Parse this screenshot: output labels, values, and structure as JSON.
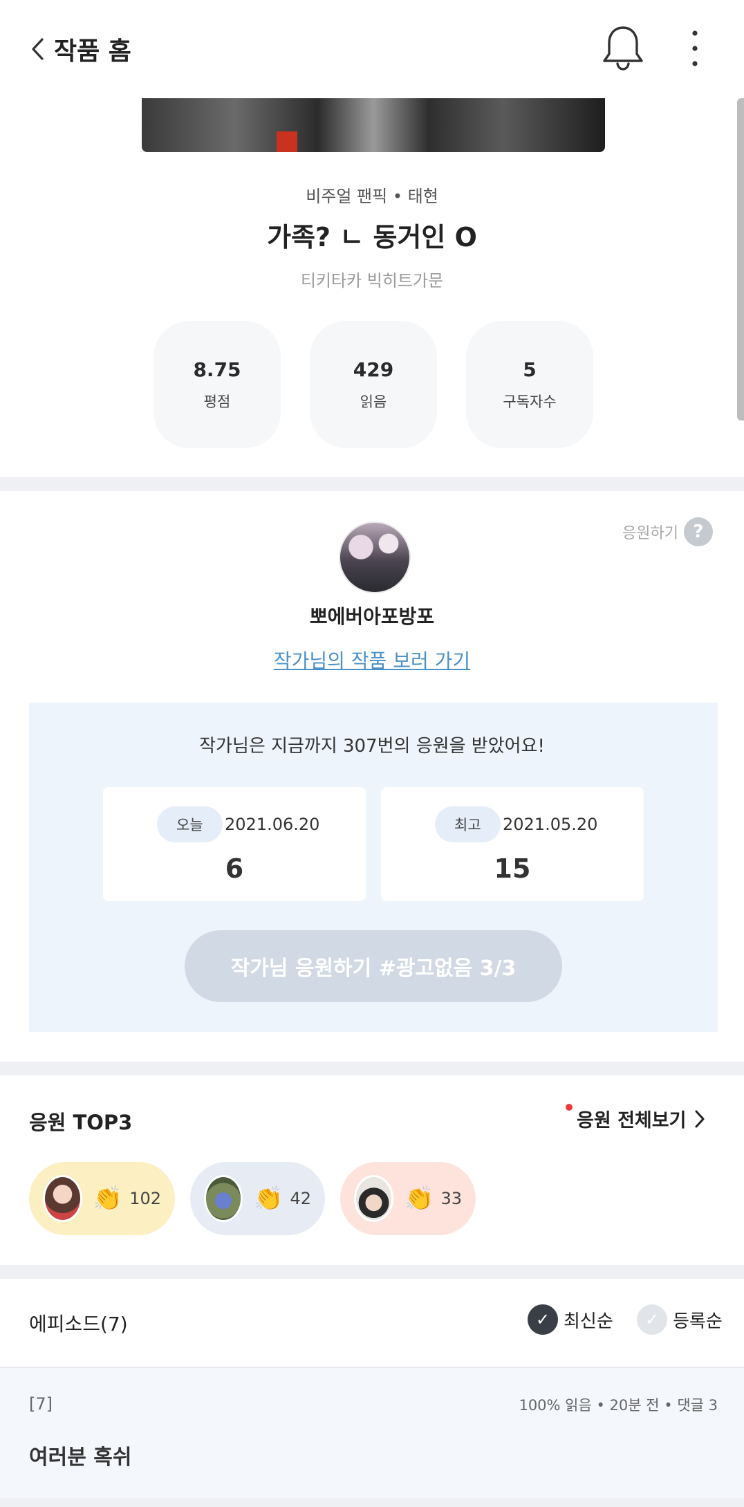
{
  "header": {
    "back_label": "작품 홈",
    "icons": [
      "chevron-left-icon",
      "bell-icon",
      "more-vertical-icon"
    ]
  },
  "work": {
    "genre": "비주얼 팬픽 • 태현",
    "title": "가족? ㄴ 동거인 O",
    "tags": "티키타카 빅히트가문",
    "stats": [
      {
        "value": "8.75",
        "label": "평점"
      },
      {
        "value": "429",
        "label": "읽음"
      },
      {
        "value": "5",
        "label": "구독자수"
      }
    ]
  },
  "author": {
    "support_help": "응원하기",
    "help_icon": "?",
    "name": "뽀에버아포방포",
    "link": "작가님의 작품 보러 가기"
  },
  "support": {
    "summary": "작가님은 지금까지 307번의 응원을 받았어요!",
    "today": {
      "tag": "오늘",
      "date": "2021.06.20",
      "count": "6"
    },
    "best": {
      "tag": "최고",
      "date": "2021.05.20",
      "count": "15"
    },
    "button": "작가님 응원하기 #광고없음 3/3"
  },
  "top3": {
    "title": "응원 TOP3",
    "view_all": "응원 전체보기",
    "fans": [
      {
        "count": "102",
        "bg": "#fcefc2"
      },
      {
        "count": "42",
        "bg": "#e7ebf3"
      },
      {
        "count": "33",
        "bg": "#fde3dc"
      }
    ]
  },
  "episodes": {
    "title": "에피소드(7)",
    "sort_latest": "최신순",
    "sort_registered": "등록순",
    "items": [
      {
        "num": "[7]",
        "meta": "100% 읽음 • 20분 전 • 댓글 3",
        "name": "여러분 혹쉬"
      }
    ]
  },
  "colors": {
    "accent_link": "#4a90c8",
    "panel_bg": "#eef4fb",
    "button_disabled": "#d1d9e5"
  }
}
